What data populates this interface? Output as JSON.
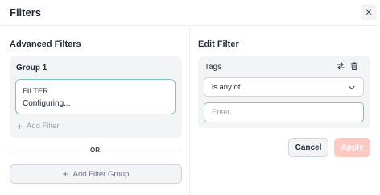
{
  "dialog": {
    "title": "Filters",
    "close_icon": "close-icon"
  },
  "advanced": {
    "heading": "Advanced Filters",
    "group": {
      "label": "Group 1",
      "filter": {
        "name": "FILTER",
        "status": "Configuring..."
      },
      "add_filter_label": "Add Filter"
    },
    "or_label": "OR",
    "add_group_label": "Add Filter Group"
  },
  "edit": {
    "heading": "Edit Filter",
    "field_label": "Tags",
    "icons": [
      "swap-icon",
      "trash-icon"
    ],
    "operator": "is any of",
    "value": "",
    "value_placeholder": "Enter",
    "cancel_label": "Cancel",
    "apply_label": "Apply"
  },
  "colors": {
    "accent_border": "#7cc4bf",
    "apply_disabled": "#fdc9c3",
    "panel_bg": "#f3f4f6"
  }
}
